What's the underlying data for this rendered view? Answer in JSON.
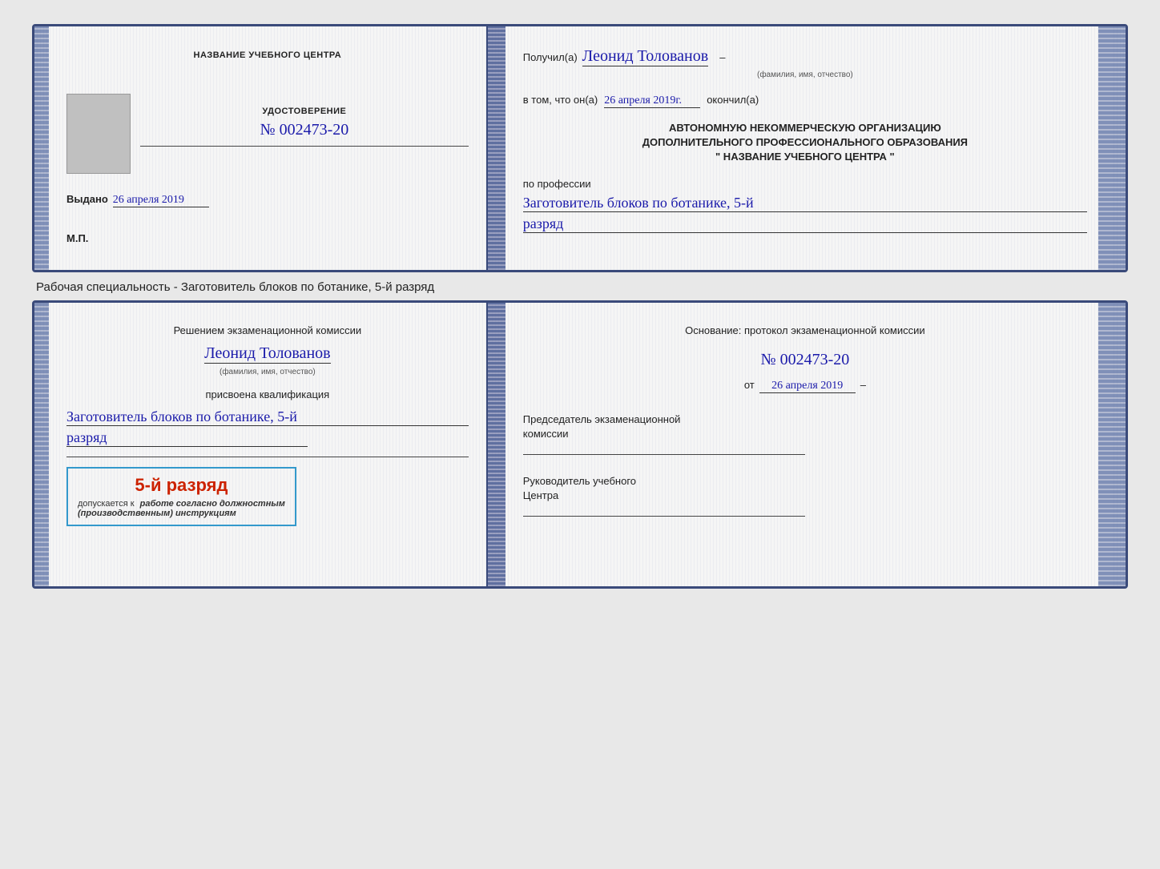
{
  "top_card": {
    "left": {
      "title_label": "НАЗВАНИЕ УЧЕБНОГО ЦЕНТРА",
      "cert_label": "УДОСТОВЕРЕНИЕ",
      "cert_number": "№ 002473-20",
      "issued_label": "Выдано",
      "issued_date": "26 апреля 2019",
      "mp_label": "М.П."
    },
    "right": {
      "received_prefix": "Получил(а)",
      "recipient_name": "Леонид Толованов",
      "fio_label": "(фамилия, имя, отчество)",
      "confirm_text": "в том, что он(а)",
      "date_handwritten": "26 апреля 2019г.",
      "finished_label": "окончил(а)",
      "org_line1": "АВТОНОМНУЮ НЕКОММЕРЧЕСКУЮ ОРГАНИЗАЦИЮ",
      "org_line2": "ДОПОЛНИТЕЛЬНОГО ПРОФЕССИОНАЛЬНОГО ОБРАЗОВАНИЯ",
      "org_name": "\"  НАЗВАНИЕ УЧЕБНОГО ЦЕНТРА  \"",
      "profession_label": "по профессии",
      "profession_name": "Заготовитель блоков по ботанике, 5-й",
      "rank_text": "разряд"
    }
  },
  "middle_label": "Рабочая специальность - Заготовитель блоков по ботанике, 5-й разряд",
  "bottom_card": {
    "left": {
      "decision_text": "Решением экзаменационной комиссии",
      "person_name": "Леонид Толованов",
      "fio_label": "(фамилия, имя, отчество)",
      "assigned_label": "присвоена квалификация",
      "qualification_line1": "Заготовитель блоков по ботанике, 5-й",
      "qualification_line2": "разряд",
      "stamp_rank": "5-й разряд",
      "stamp_allowed_prefix": "допускается к",
      "stamp_allowed_text": "работе согласно должностным",
      "stamp_allowed_text2": "(производственным) инструкциям"
    },
    "right": {
      "basis_label": "Основание: протокол экзаменационной комиссии",
      "protocol_number": "№  002473-20",
      "date_prefix": "от",
      "date_value": "26 апреля 2019",
      "chairman_label": "Председатель экзаменационной",
      "chairman_label2": "комиссии",
      "head_label": "Руководитель учебного",
      "head_label2": "Центра"
    }
  }
}
